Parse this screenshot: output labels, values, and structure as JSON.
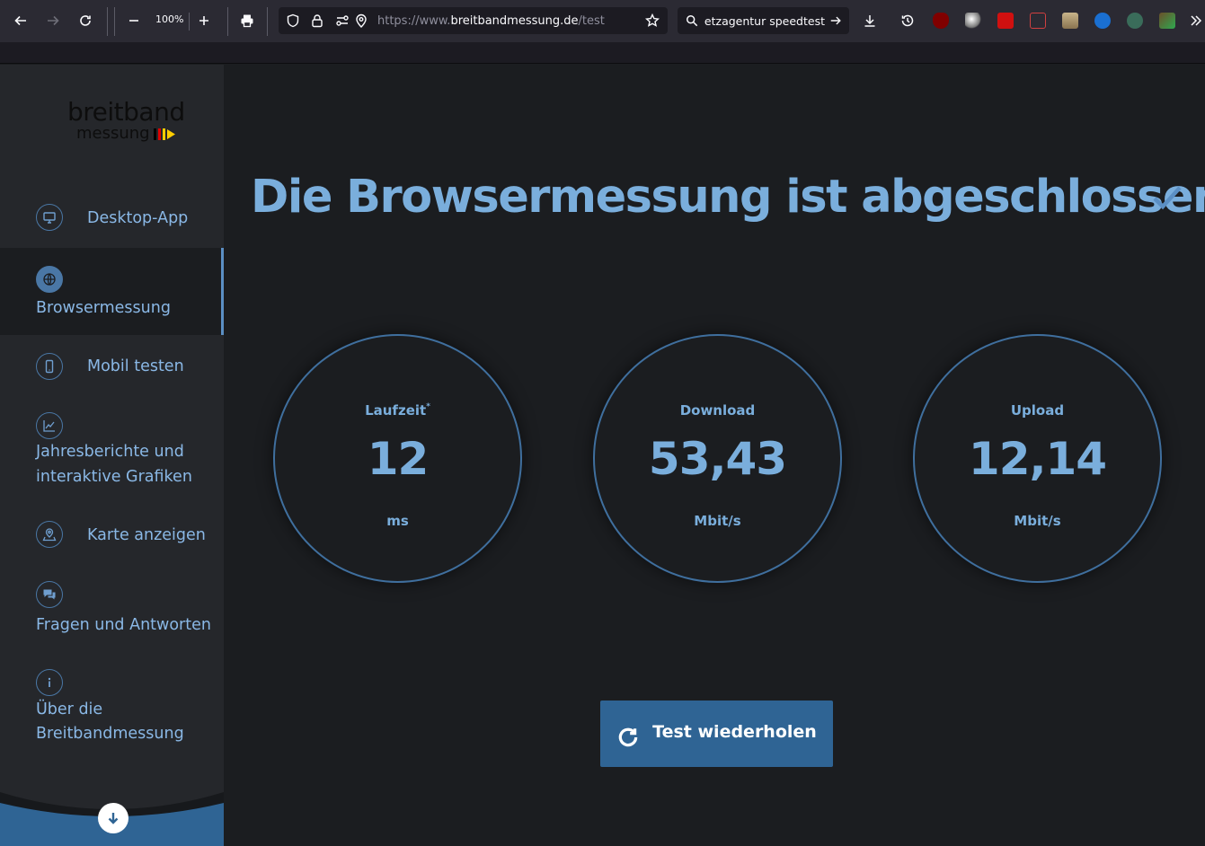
{
  "browser": {
    "zoom": "100%",
    "url_scheme": "https://www.",
    "url_host": "breitbandmessung.de",
    "url_path": "/test",
    "search_text": "netzagentur speedtest"
  },
  "sidebar": {
    "logo_main": "breitband",
    "logo_sub": "messung",
    "items": [
      {
        "label": "Desktop-App",
        "icon": "desktop-icon"
      },
      {
        "label": "Browsermessung",
        "icon": "globe-icon",
        "active": true
      },
      {
        "label": "Mobil testen",
        "icon": "mobile-icon"
      },
      {
        "label": "Jahresberichte und",
        "label2": "interaktive Grafiken",
        "icon": "chart-icon"
      },
      {
        "label": "Karte anzeigen",
        "icon": "map-pin-icon"
      },
      {
        "label": "Fragen und Antworten",
        "icon": "chat-icon"
      },
      {
        "label": "Über die",
        "label2": "Breitbandmessung",
        "icon": "info-icon"
      }
    ]
  },
  "main": {
    "headline": "Die Browsermessung ist abgeschlossen.",
    "gauges": [
      {
        "label": "Laufzeit",
        "marker": "*",
        "value": "12",
        "unit": "ms"
      },
      {
        "label": "Download",
        "value": "53,43",
        "unit": "Mbit/s"
      },
      {
        "label": "Upload",
        "value": "12,14",
        "unit": "Mbit/s"
      }
    ],
    "retry_label": "Test wiederholen"
  },
  "colors": {
    "accent": "#7aaedc",
    "button": "#2f6494",
    "sidebar_bg": "#25272b",
    "main_bg": "#1b1d20"
  }
}
